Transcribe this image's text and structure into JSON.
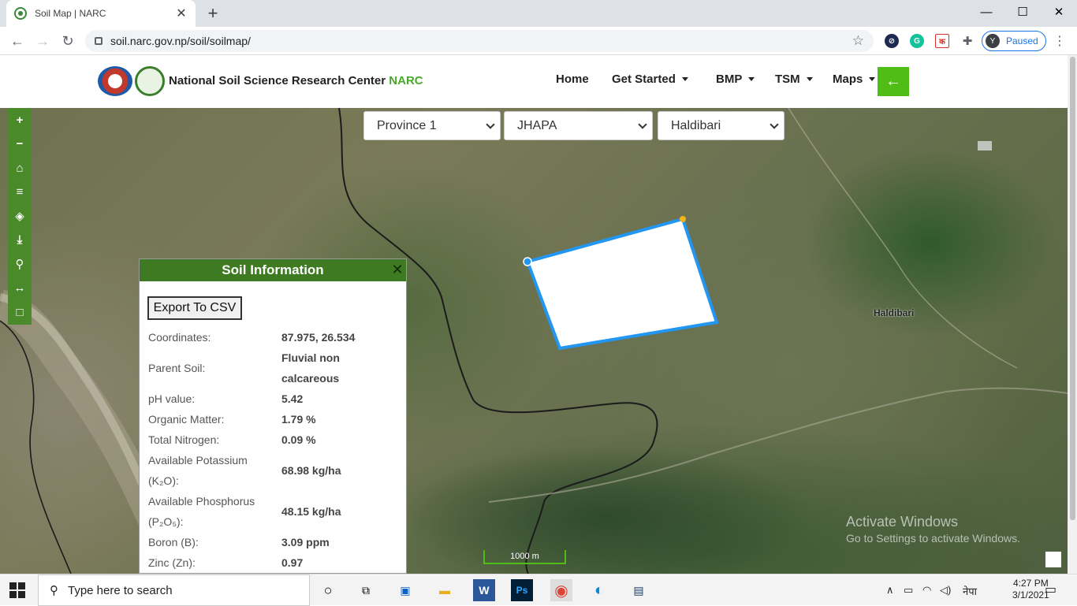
{
  "browser": {
    "tab_title": "Soil Map | NARC",
    "tab_close": "✕",
    "new_tab": "+",
    "url": "soil.narc.gov.np/soil/soilmap/",
    "window_controls": {
      "minimize": "—",
      "maximize": "☐",
      "close": "✕"
    },
    "profile_initial": "Y",
    "profile_status": "Paused",
    "extensions": [
      {
        "icon": "compass-extension-icon",
        "color": "#1e2a50"
      },
      {
        "icon": "grammarly-extension-icon",
        "color": "#15c39a"
      },
      {
        "icon": "nepali-keyboard-extension-icon",
        "color": "#d93025",
        "glyph": "क"
      },
      {
        "icon": "puzzle-extensions-icon",
        "color": "#5f6368"
      }
    ]
  },
  "site": {
    "name": "National Soil Science Research Center",
    "name_accent": "NARC",
    "nav": [
      {
        "label": "Home",
        "dropdown": false
      },
      {
        "label": "Get Started",
        "dropdown": true
      },
      {
        "label": "BMP",
        "dropdown": true
      },
      {
        "label": "TSM",
        "dropdown": true
      },
      {
        "label": "Maps",
        "dropdown": true
      }
    ],
    "back_icon": "arrow-left-icon",
    "accent_color": "#4fbd16"
  },
  "map": {
    "controls": [
      {
        "name": "zoom-in-icon",
        "glyph": "+"
      },
      {
        "name": "zoom-out-icon",
        "glyph": "−"
      },
      {
        "name": "home-icon",
        "glyph": "⌂"
      },
      {
        "name": "menu-icon",
        "glyph": "≡"
      },
      {
        "name": "layers-icon",
        "glyph": "◈"
      },
      {
        "name": "download-icon",
        "glyph": "⤓"
      },
      {
        "name": "location-pin-icon",
        "glyph": "⚲"
      },
      {
        "name": "measure-distance-icon",
        "glyph": "↔"
      },
      {
        "name": "measure-area-icon",
        "glyph": "□"
      }
    ],
    "province_select": "Province 1",
    "district_select": "JHAPA",
    "municipality_select": "Haldibari",
    "place_label": "Haldibari",
    "scale_label": "1000 m"
  },
  "soil_info": {
    "title": "Soil Information",
    "export_label": "Export To CSV",
    "rows": [
      {
        "key": "Coordinates:",
        "value": "87.975, 26.534"
      },
      {
        "key": "Parent Soil:",
        "value": "Fluvial non calcareous"
      },
      {
        "key": "pH value:",
        "value": "5.42"
      },
      {
        "key": "Organic Matter:",
        "value": "1.79 %"
      },
      {
        "key": "Total Nitrogen:",
        "value": "0.09 %"
      },
      {
        "key": "Available Potassium",
        "key_formula": "(K₂O):",
        "value": "68.98 kg/ha"
      },
      {
        "key": "Available Phosphorus",
        "key_formula": "(P₂O₅):",
        "value": "48.15 kg/ha"
      },
      {
        "key": "Boron (B):",
        "value": "3.09 ppm"
      },
      {
        "key": "Zinc (Zn):",
        "value": "0.97"
      }
    ]
  },
  "watermark": {
    "line1": "Activate Windows",
    "line2": "Go to Settings to activate Windows."
  },
  "taskbar": {
    "search_placeholder": "Type here to search",
    "apps": [
      "cortana-icon",
      "task-view-icon",
      "store-icon",
      "file-explorer-icon",
      "word-icon",
      "photoshop-icon",
      "chrome-icon",
      "edge-icon",
      "remote-desktop-icon"
    ],
    "language": "नेपा",
    "time": "4:27 PM",
    "date": "3/1/2021"
  }
}
